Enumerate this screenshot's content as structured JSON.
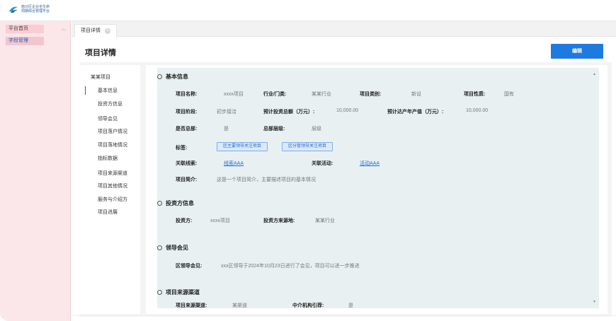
{
  "header": {
    "logo_line1": "南沙区企业全生命",
    "logo_line2": "周期综合管理平台"
  },
  "sidebar": {
    "items": [
      {
        "label": "平台首页"
      },
      {
        "label": "字段管理"
      }
    ]
  },
  "tabs": [
    {
      "label": "项目详情"
    }
  ],
  "page": {
    "title": "项目详情",
    "edit_label": "编辑"
  },
  "anchor_nav": {
    "head": "某某项目",
    "items": [
      "基本信息",
      "投资方信息",
      "领导会见",
      "项目落户情况",
      "项目落地情况",
      "指标数据",
      "项目来源渠道",
      "项目其他情况",
      "服务与介绍方",
      "项目进展"
    ]
  },
  "basic_info": {
    "title": "基本信息",
    "name_label": "项目名称:",
    "name_value": "xxxx项目",
    "industry_label": "行业/门类:",
    "industry_value": "某某行业",
    "category_label": "项目类别:",
    "category_value": "新设",
    "nature_label": "项目性质:",
    "nature_value": "国有",
    "stage_label": "项目阶段:",
    "stage_value": "初步接洽",
    "invest_label": "预计投资总额（万元）:",
    "invest_value": "10,000.00",
    "output_label": "预计达产年产值（万元）:",
    "output_value": "10,000.00",
    "hq_label": "是否总部:",
    "hq_value": "是",
    "hq_level_label": "总部层级:",
    "hq_level_value": "层级",
    "tags_label": "标签:",
    "tags": [
      "区主要领导关注项目",
      "区分管领导关注项目"
    ],
    "clue_label": "关联线索:",
    "clue_value": "线索AAA",
    "activity_label": "关联活动:",
    "activity_value": "活动AAA",
    "intro_label": "项目简介:",
    "intro_value": "这是一个项目简介，主要描述项目的基本情况"
  },
  "investor_info": {
    "title": "投资方信息",
    "investor_label": "投资方:",
    "investor_value": "xxxx项目",
    "origin_label": "投资方来源地:",
    "origin_value": "某某行业"
  },
  "leader_meeting": {
    "title": "领导会见",
    "meeting_label": "区领导会见:",
    "meeting_value": "xxx区领导于2024年10月23日进行了会见，项目可以进一步推进"
  },
  "source_channel": {
    "title": "项目来源渠道",
    "channel_label": "项目来源渠道:",
    "channel_value": "某渠道",
    "agency_label": "中介机构引荐:",
    "agency_value": "是"
  },
  "colors": {
    "primary": "#1f7ae0",
    "sidebar_bg": "#fbe6e9",
    "panel_bg": "#e8f0f2",
    "link": "#1f6fd0"
  }
}
